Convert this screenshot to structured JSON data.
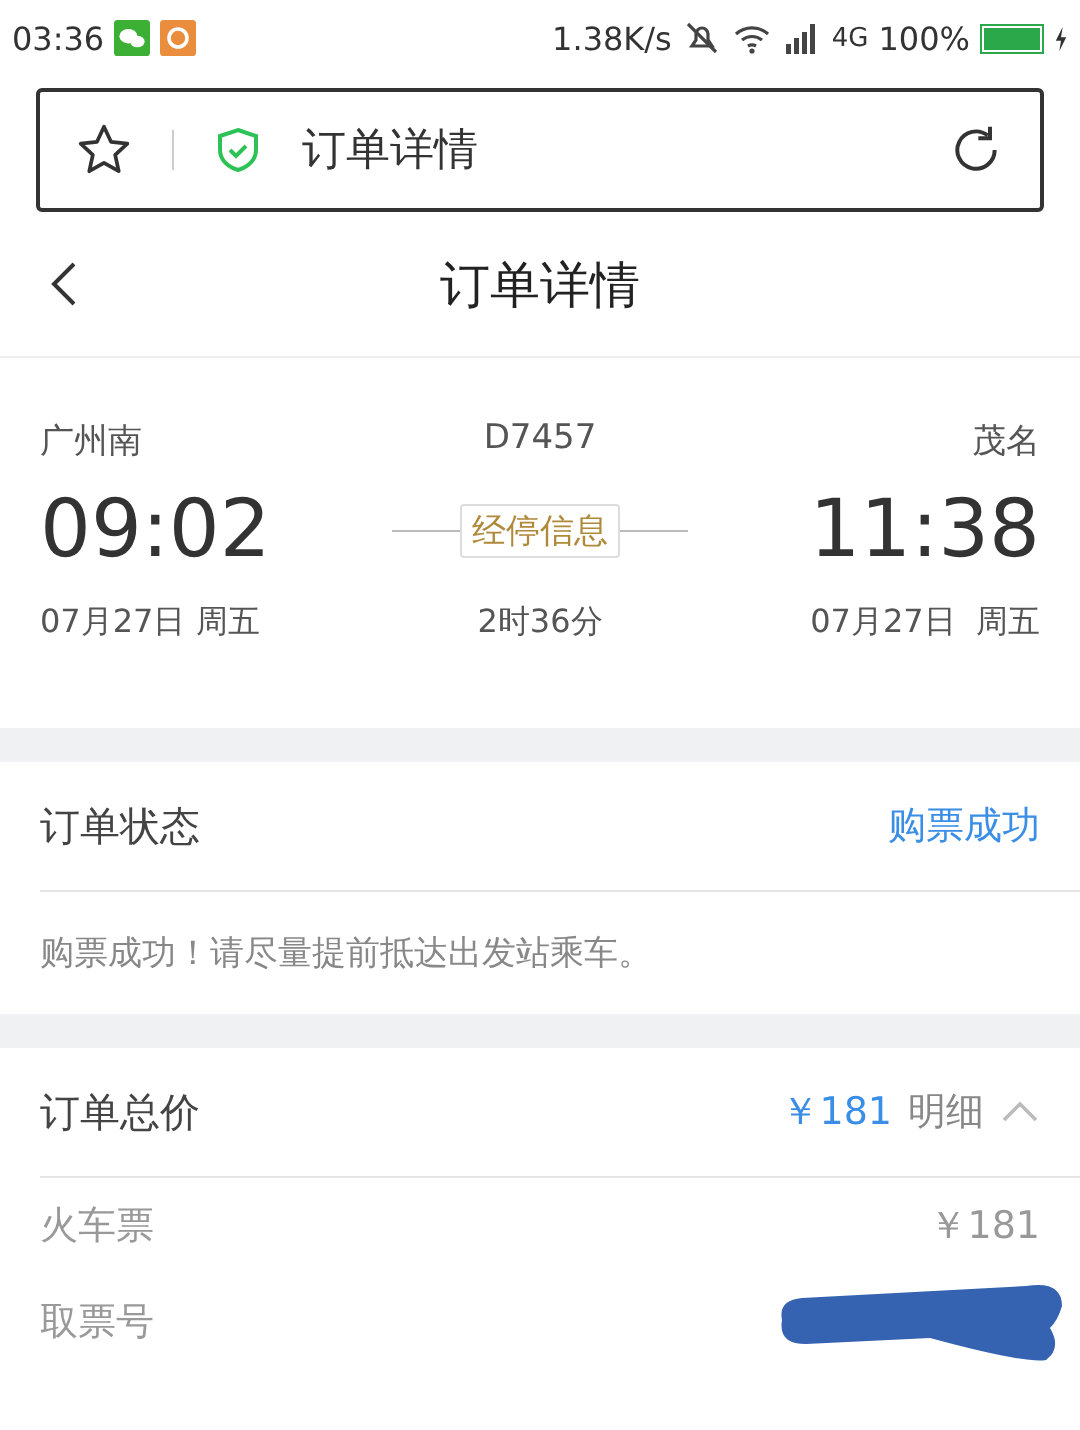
{
  "status_bar": {
    "time": "03:36",
    "speed": "1.38K/s",
    "network": "4G",
    "battery": "100%"
  },
  "address_bar": {
    "title": "订单详情",
    "secure": true
  },
  "header": {
    "title": "订单详情"
  },
  "trip": {
    "from": {
      "station": "广州南",
      "time": "09:02",
      "date": "07月27日 周五"
    },
    "train": "D7457",
    "stops_button": "经停信息",
    "duration": "2时36分",
    "to": {
      "station": "茂名",
      "time": "11:38",
      "date": "07月27日  周五"
    }
  },
  "order_status": {
    "label": "订单状态",
    "value": "购票成功",
    "message": "购票成功！请尽量提前抵达出发站乘车。"
  },
  "order_total": {
    "label": "订单总价",
    "amount": "￥181",
    "detail": "明细",
    "expanded": true,
    "rows": [
      {
        "label": "火车票",
        "value": "￥181",
        "redacted": false
      },
      {
        "label": "取票号",
        "value": "",
        "redacted": true
      }
    ]
  }
}
